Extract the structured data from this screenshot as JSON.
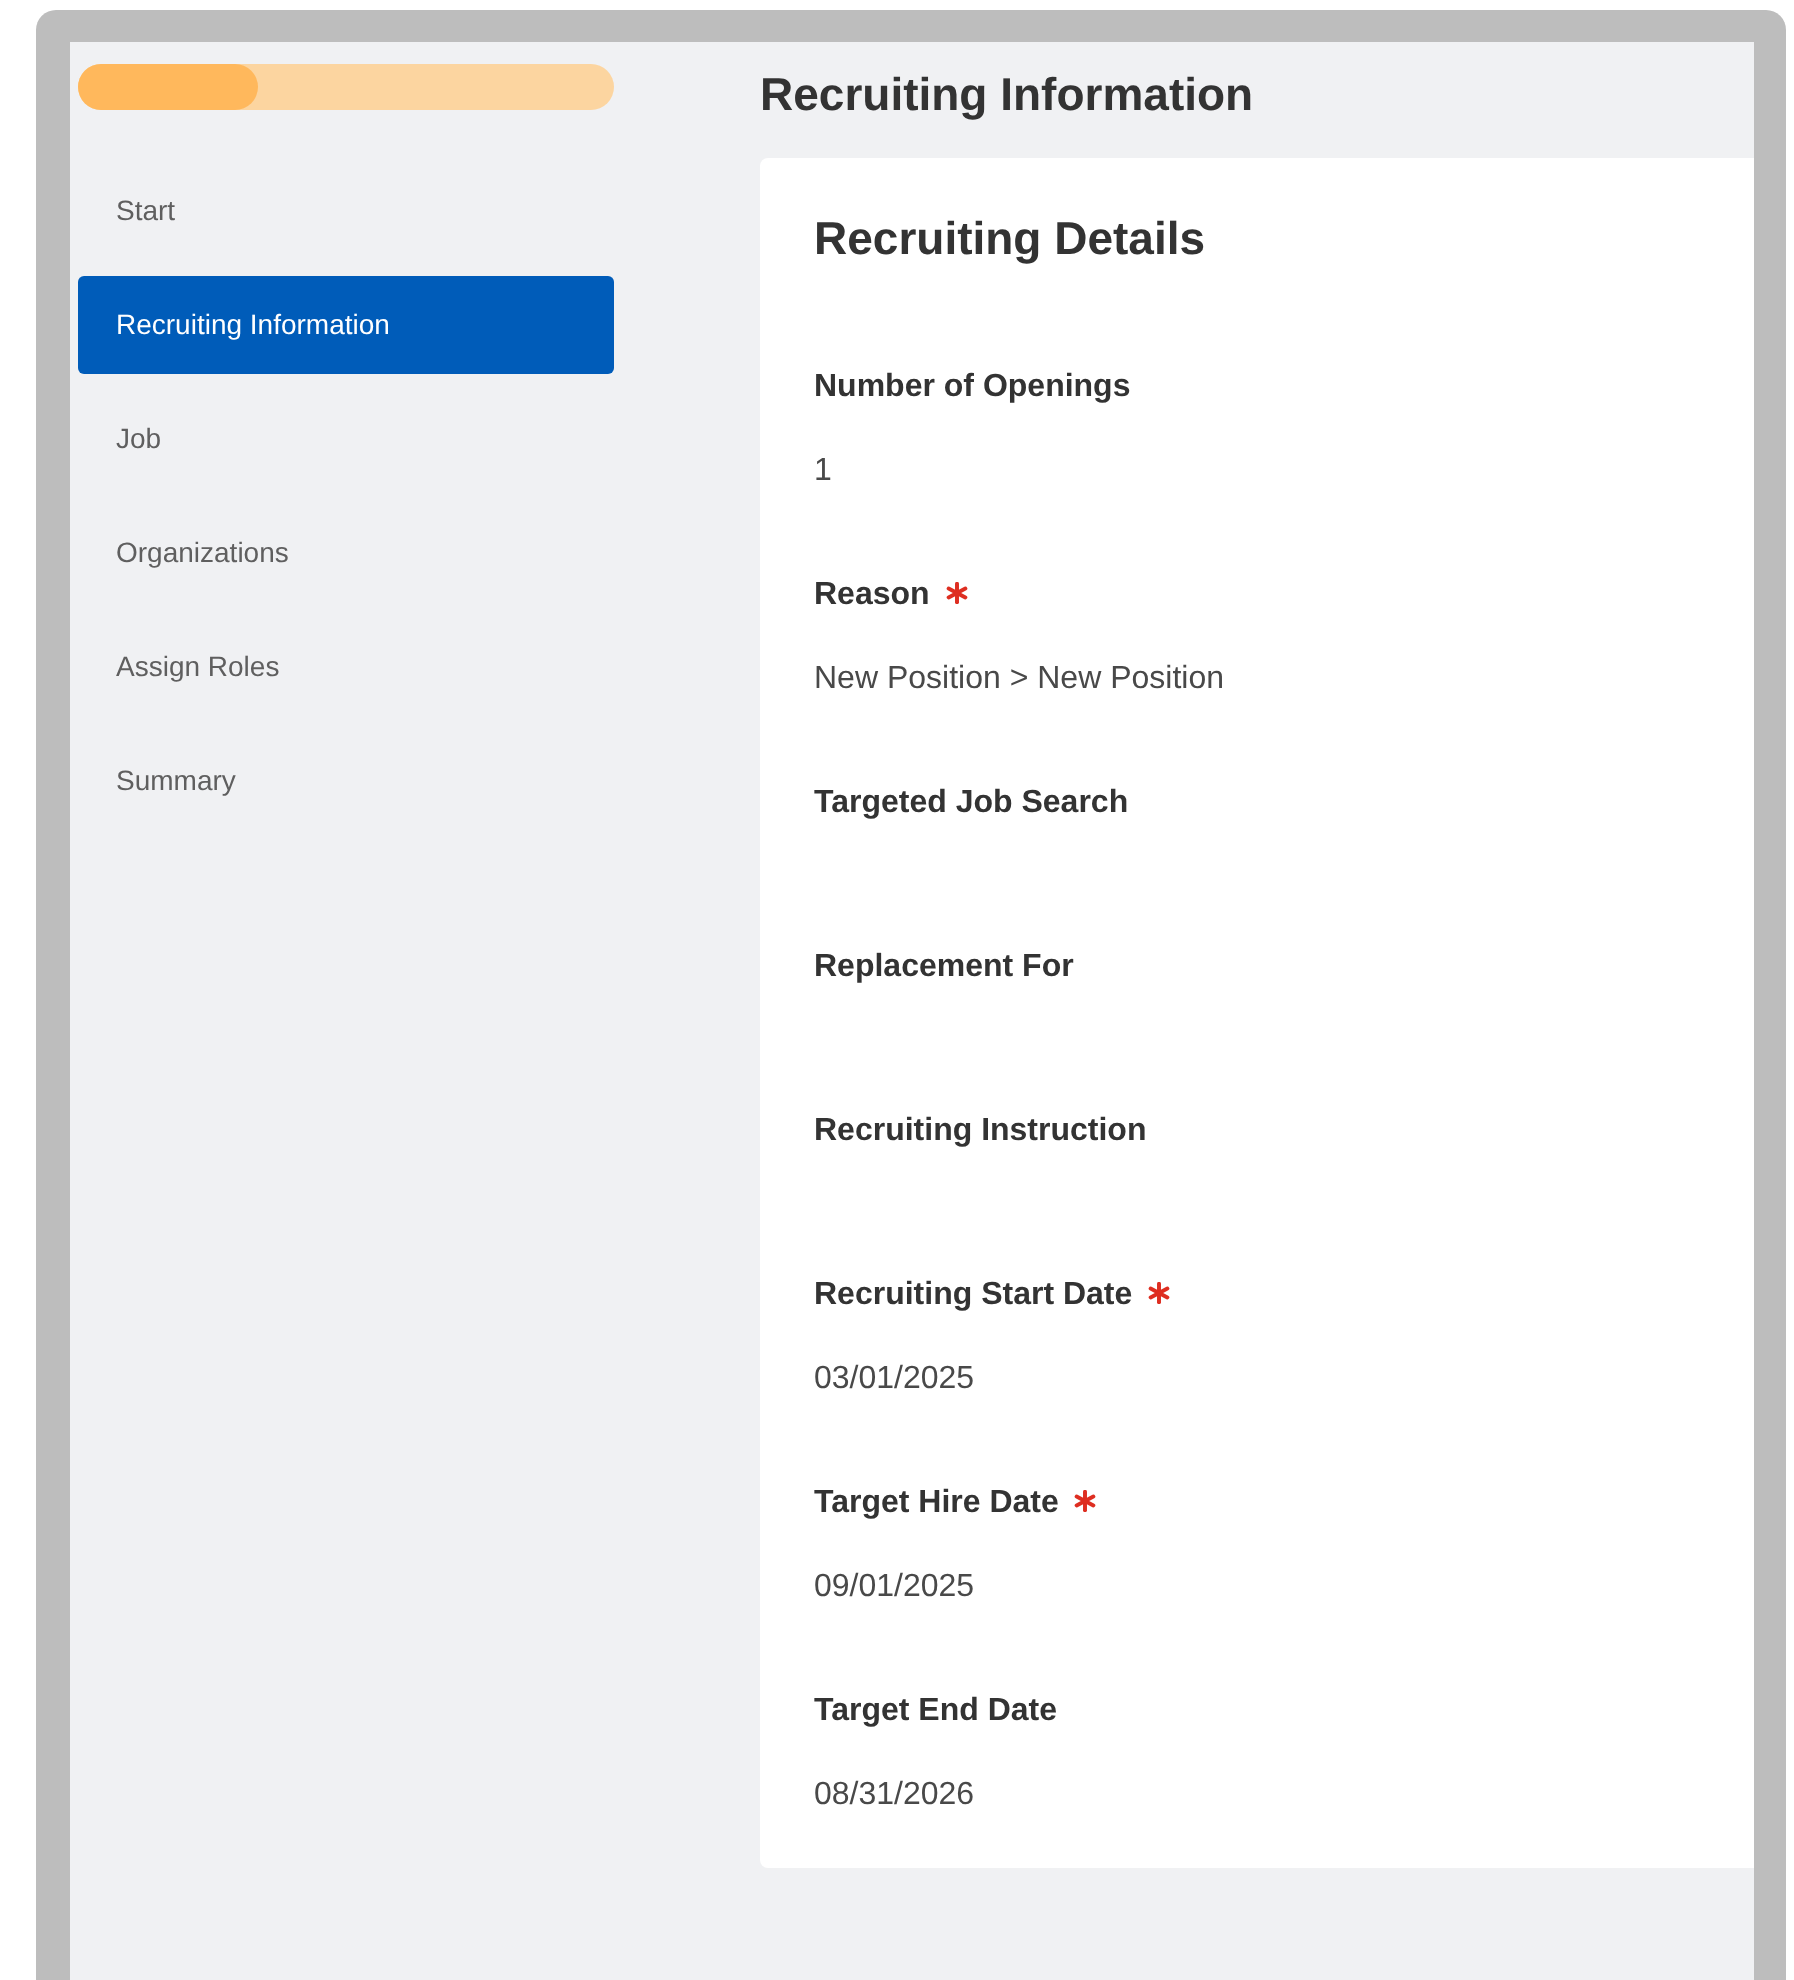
{
  "progress": {
    "level": 0.335
  },
  "steps": [
    {
      "label": "Start",
      "selected": false
    },
    {
      "label": "Recruiting Information",
      "selected": true
    },
    {
      "label": "Job",
      "selected": false
    },
    {
      "label": "Organizations",
      "selected": false
    },
    {
      "label": "Assign Roles",
      "selected": false
    },
    {
      "label": "Summary",
      "selected": false
    }
  ],
  "page_title": "Recruiting Information",
  "card": {
    "title": "Recruiting Details",
    "fields": [
      {
        "label": "Number of Openings",
        "required": false,
        "value": "1"
      },
      {
        "label": "Reason",
        "required": true,
        "value": "New Position > New Position"
      },
      {
        "label": "Targeted Job Search",
        "required": false
      },
      {
        "label": "Replacement For",
        "required": false
      },
      {
        "label": "Recruiting Instruction",
        "required": false
      },
      {
        "label": "Recruiting Start Date",
        "required": true,
        "value": "03/01/2025"
      },
      {
        "label": "Target Hire Date",
        "required": true,
        "value": "09/01/2025"
      },
      {
        "label": "Target End Date",
        "required": false,
        "value": "08/31/2026"
      }
    ]
  }
}
